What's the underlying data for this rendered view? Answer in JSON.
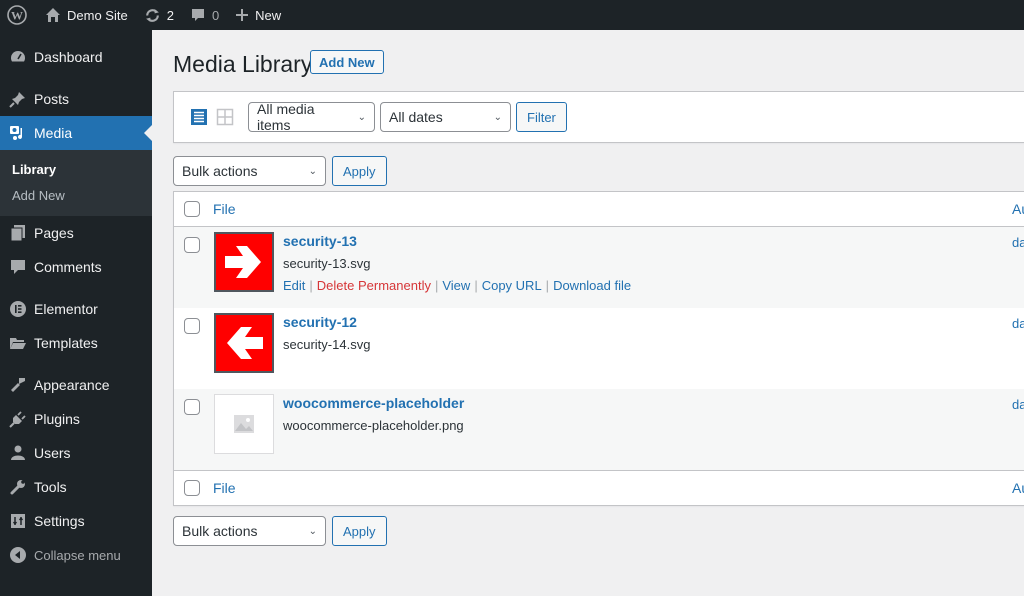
{
  "adminbar": {
    "site_name": "Demo Site",
    "updates_count": "2",
    "comments_count": "0",
    "new_label": "New"
  },
  "sidebar": {
    "items": [
      {
        "label": "Dashboard",
        "icon": "dashboard-icon"
      },
      {
        "label": "Posts",
        "icon": "pin-icon"
      },
      {
        "label": "Media",
        "icon": "media-icon",
        "active": true
      },
      {
        "label": "Pages",
        "icon": "pages-icon"
      },
      {
        "label": "Comments",
        "icon": "comment-icon"
      },
      {
        "label": "Elementor",
        "icon": "elementor-icon"
      },
      {
        "label": "Templates",
        "icon": "folder-icon"
      },
      {
        "label": "Appearance",
        "icon": "paintbrush-icon"
      },
      {
        "label": "Plugins",
        "icon": "plugin-icon"
      },
      {
        "label": "Users",
        "icon": "user-icon"
      },
      {
        "label": "Tools",
        "icon": "wrench-icon"
      },
      {
        "label": "Settings",
        "icon": "settings-icon"
      }
    ],
    "submenu": [
      {
        "label": "Library",
        "current": true
      },
      {
        "label": "Add New"
      }
    ],
    "collapse_label": "Collapse menu"
  },
  "main": {
    "title": "Media Library",
    "add_new_label": "Add New",
    "filters": {
      "media_type": "All media items",
      "dates": "All dates",
      "filter_label": "Filter"
    },
    "bulk": {
      "select_label": "Bulk actions",
      "apply_label": "Apply"
    },
    "table": {
      "columns": [
        "File",
        "Au"
      ],
      "rows": [
        {
          "title": "security-13",
          "filename": "security-13.svg",
          "author": "da",
          "thumb": "arrow-right",
          "actions": [
            "Edit",
            "Delete Permanently",
            "View",
            "Copy URL",
            "Download file"
          ]
        },
        {
          "title": "security-12",
          "filename": "security-14.svg",
          "author": "da",
          "thumb": "arrow-left"
        },
        {
          "title": "woocommerce-placeholder",
          "filename": "woocommerce-placeholder.png",
          "author": "da",
          "thumb": "image-placeholder"
        }
      ]
    }
  },
  "colors": {
    "accent": "#2271b1",
    "adminbar_bg": "#1d2327",
    "danger": "#d63638",
    "thumb_red": "#ff0000"
  }
}
